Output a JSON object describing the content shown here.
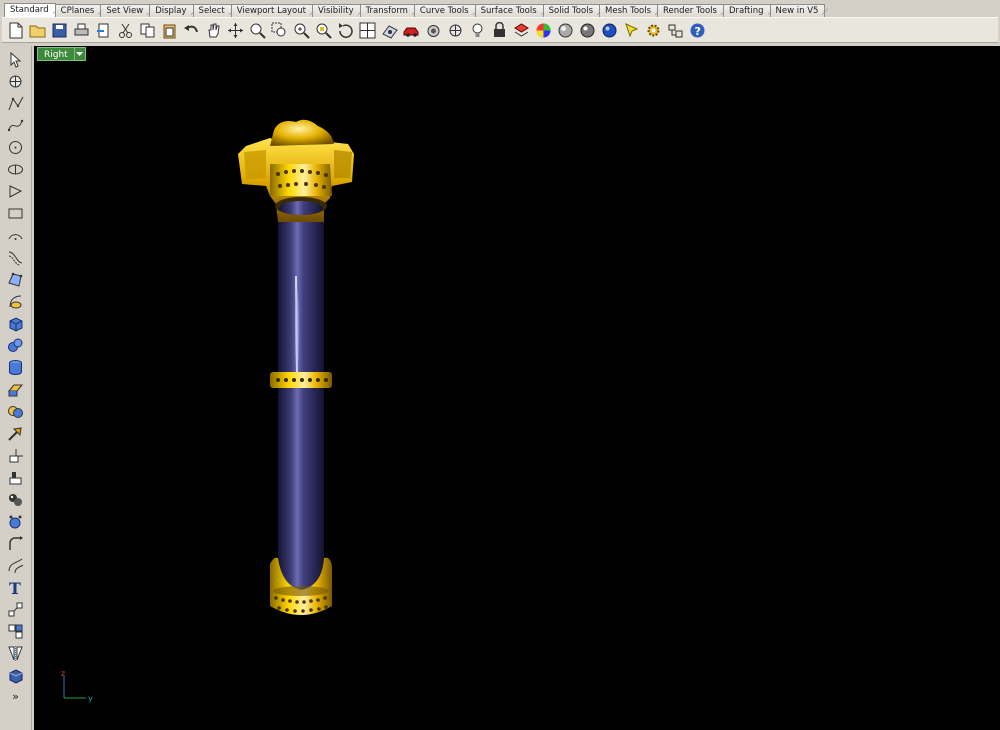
{
  "tabs": [
    "Standard",
    "CPlanes",
    "Set View",
    "Display",
    "Select",
    "Viewport Layout",
    "Visibility",
    "Transform",
    "Curve Tools",
    "Surface Tools",
    "Solid Tools",
    "Mesh Tools",
    "Render Tools",
    "Drafting",
    "New in V5"
  ],
  "active_tab": "Standard",
  "toolbar_icons": [
    "new-file-icon",
    "open-folder-icon",
    "save-icon",
    "print-icon",
    "import-icon",
    "cut-icon",
    "copy-icon",
    "paste-icon",
    "undo-icon",
    "pan-hand-icon",
    "move-view-icon",
    "zoom-icon",
    "zoom-window-icon",
    "zoom-extents-icon",
    "zoom-selected-icon",
    "rotate-view-icon",
    "four-viewports-icon",
    "cplane-icon",
    "car-icon",
    "camera-icon",
    "point-icon",
    "lightbulb-icon",
    "lock-icon",
    "layer-icon",
    "color-wheel-icon",
    "shade-sphere-icon",
    "rendered-sphere-icon",
    "render-sphere-icon",
    "paint-icon",
    "settings-gear-icon",
    "options-icon",
    "help-icon"
  ],
  "left_tool_icons": [
    "select-arrow-icon",
    "point-icon",
    "polyline-icon",
    "curve-icon",
    "circle-icon",
    "ellipse-icon",
    "polygon-icon",
    "rectangle-icon",
    "arc-icon",
    "curve-offset-icon",
    "surface-points-icon",
    "surface-revolve-icon",
    "solid-box-icon",
    "solid-spheres-icon",
    "solid-cylinder-icon",
    "extrude-icon",
    "boolean-icon",
    "move-arrow-icon",
    "transform-icon",
    "align-icon",
    "mesh-icon",
    "mesh-points-icon",
    "fillet-curve-icon",
    "blend-curve-icon",
    "text-icon",
    "dimension-icon",
    "block-icon",
    "mirror-icon",
    "render-cube-icon"
  ],
  "more_label": "»",
  "viewport": {
    "name": "Right",
    "background": "#000000"
  },
  "axis": {
    "z": "z",
    "y": "y"
  },
  "colors": {
    "gold": "#e6b800",
    "shaft": "#2d2c5a",
    "view_tab": "#3d8a3d"
  }
}
